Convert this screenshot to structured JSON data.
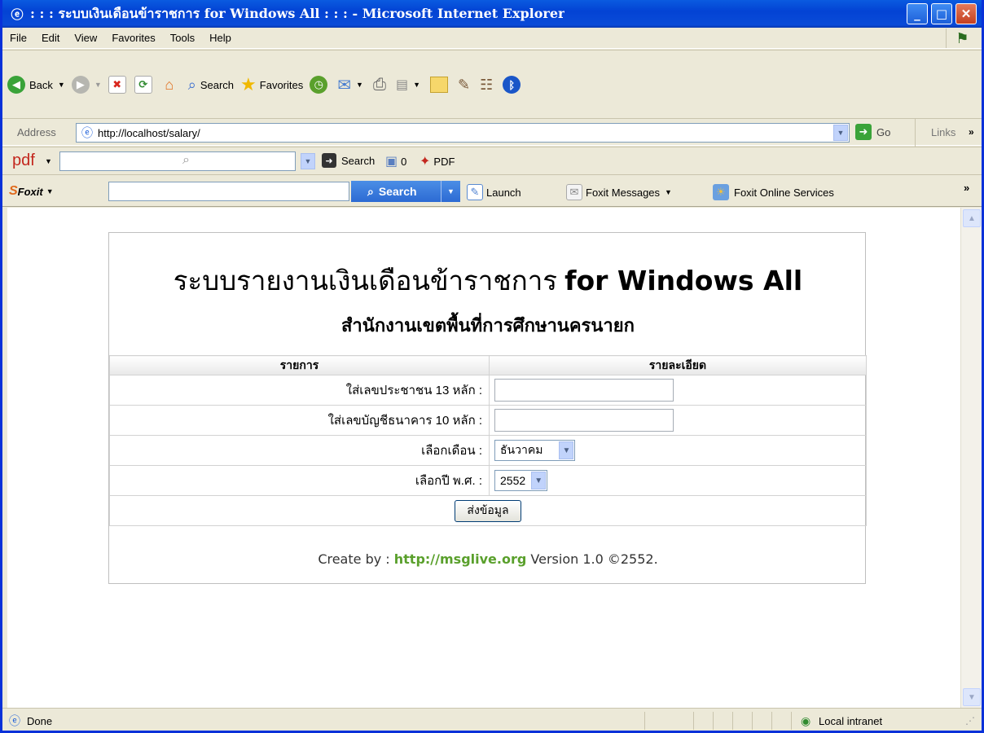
{
  "window": {
    "title": ": : : ระบบเงินเดือนข้าราชการ for Windows All : : : - Microsoft Internet Explorer"
  },
  "menu": [
    "File",
    "Edit",
    "View",
    "Favorites",
    "Tools",
    "Help"
  ],
  "toolbar": {
    "back": "Back",
    "search": "Search",
    "favorites": "Favorites"
  },
  "address": {
    "label": "Address",
    "url": "http://localhost/salary/",
    "go": "Go",
    "links": "Links"
  },
  "pdfbar": {
    "brand": "pdf",
    "search": "Search",
    "count": "0",
    "pdf": "PDF"
  },
  "foxitbar": {
    "brand": "Foxit",
    "search": "Search",
    "launch": "Launch",
    "messages": "Foxit Messages",
    "online": "Foxit Online Services"
  },
  "page": {
    "title_thai": "ระบบรายงานเงินเดือนข้าราชการ",
    "title_en": "for Windows All",
    "subtitle": "สำนักงานเขตพื้นที่การศึกษานครนายก",
    "col_item": "รายการ",
    "col_detail": "รายละเอียด",
    "rows": [
      {
        "label": "ใส่เลขประชาชน 13 หลัก :"
      },
      {
        "label": "ใส่เลขบัญชีธนาคาร 10 หลัก :"
      },
      {
        "label": "เลือกเดือน :",
        "value": "ธันวาคม"
      },
      {
        "label": "เลือกปี พ.ศ. :",
        "value": "2552"
      }
    ],
    "submit": "ส่งข้อมูล",
    "footer_prefix": "Create by :",
    "footer_link": "http://msglive.org",
    "footer_suffix": "Version 1.0 ©2552."
  },
  "status": {
    "text": "Done",
    "zone": "Local intranet"
  }
}
